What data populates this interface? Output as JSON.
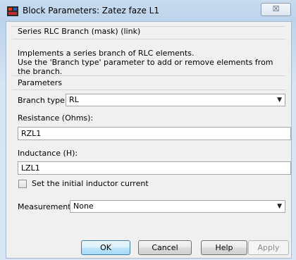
{
  "window": {
    "title": "Block Parameters: Zatez faze L1",
    "close_glyph": "☒",
    "app_icon": "simulink-block-icon"
  },
  "block": {
    "header": "Series RLC Branch (mask) (link)",
    "description_line1": "Implements a series branch of RLC elements.",
    "description_line2": "Use the 'Branch type' parameter to add or remove elements from the branch."
  },
  "parameters": {
    "section_title": "Parameters",
    "branch_type_label": "Branch type:",
    "branch_type_value": "RL",
    "resistance_label": "Resistance (Ohms):",
    "resistance_value": "RZL1",
    "inductance_label": "Inductance (H):",
    "inductance_value": "LZL1",
    "initial_current_label": "Set the initial inductor current",
    "initial_current_checked": false,
    "measurements_label": "Measurements",
    "measurements_value": "None"
  },
  "buttons": {
    "ok": "OK",
    "cancel": "Cancel",
    "help": "Help",
    "apply": "Apply"
  },
  "colors": {
    "titlebar": "#bcd3ec",
    "client": "#f0f0f0",
    "default_button": "#bee6fd"
  }
}
